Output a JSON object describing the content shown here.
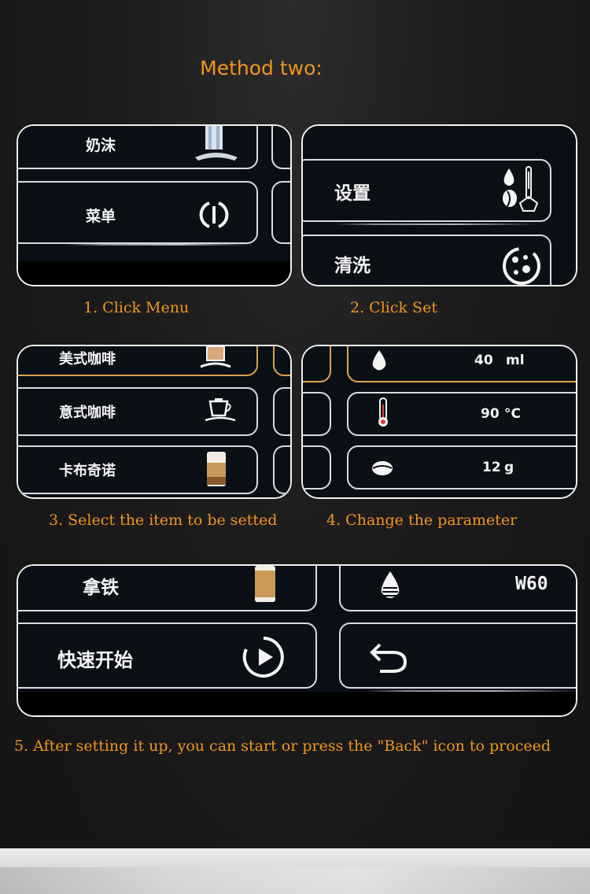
{
  "title": "Method two:",
  "captions": {
    "step1": "1. Click Menu",
    "step2": "2. Click Set",
    "step3": "3. Select the item to be setted",
    "step4": "4. Change the parameter",
    "step5": "5. After setting it up, you can start or press the \"Back\" icon to proceed"
  },
  "panel1": {
    "item_top": "奶沫",
    "item_menu": "菜单"
  },
  "panel2": {
    "item_settings": "设置",
    "item_clean": "清洗"
  },
  "panel3": {
    "item_americano": "美式咖啡",
    "item_espresso": "意式咖啡",
    "item_cappuccino": "卡布奇诺"
  },
  "panel4": {
    "water_value": "40",
    "water_unit": "ml",
    "temp_value": "90",
    "temp_unit": "°C",
    "beans_value": "12",
    "beans_unit": "g"
  },
  "panel5": {
    "item_latte": "拿铁",
    "item_quick_start": "快速开始",
    "water_hardness": "W60"
  },
  "colors": {
    "accent": "#f0961e",
    "frame": "#f2f2f2",
    "button_border": "#d9dde3",
    "selected_border": "#e0a24f"
  }
}
